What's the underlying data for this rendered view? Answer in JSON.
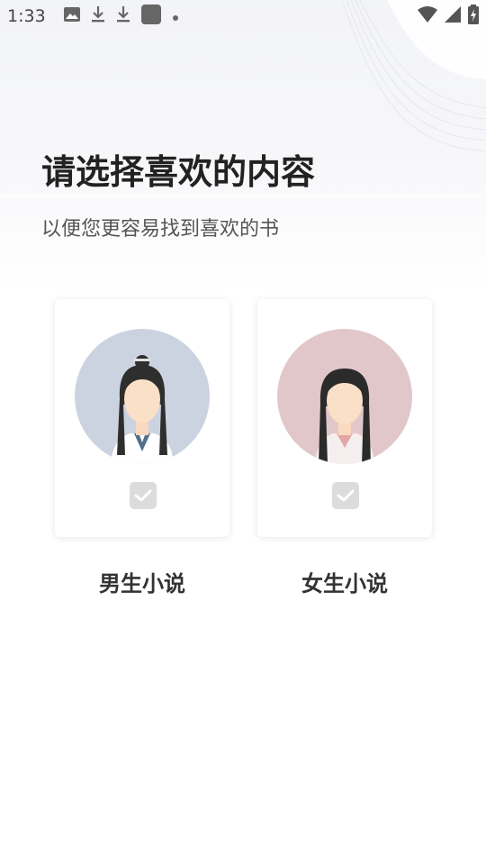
{
  "status_bar": {
    "time": "1:33",
    "left_icons": [
      "image-icon",
      "download-icon",
      "download-icon",
      "app-square-icon",
      "dot-icon"
    ],
    "right_icons": [
      "wifi-icon",
      "signal-icon",
      "battery-charging-icon"
    ]
  },
  "header": {
    "title": "请选择喜欢的内容",
    "subtitle": "以便您更容易找到喜欢的书"
  },
  "options": [
    {
      "label": "男生小说",
      "avatar_bg": "#ccd3e0",
      "selected": false
    },
    {
      "label": "女生小说",
      "avatar_bg": "#e2c7ca",
      "selected": false
    }
  ],
  "colors": {
    "background_top": "#f3f4f8",
    "checkbox_bg": "#dcdcdc",
    "title_color": "#222222",
    "subtitle_color": "#555555"
  }
}
